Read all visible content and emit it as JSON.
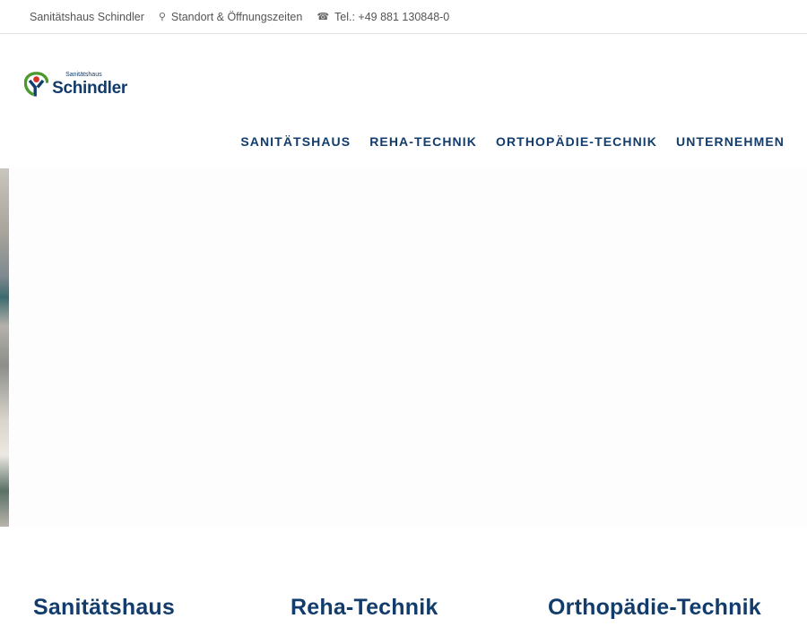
{
  "topbar": {
    "company": "Sanitätshaus Schindler",
    "location_icon": "map-pin-icon",
    "location": "Standort & Öffnungszeiten",
    "phone_icon": "phone-icon",
    "phone": "Tel.: +49 881 130848-0"
  },
  "logo": {
    "small": "Sanitätshaus",
    "big": "Schindler",
    "colors": {
      "green": "#4a9a2e",
      "red": "#d6322b",
      "blue": "#123c6b"
    }
  },
  "nav": {
    "items": [
      "SANITÄTSHAUS",
      "REHA-TECHNIK",
      "ORTHOPÄDIE-TECHNIK",
      "UNTERNEHMEN"
    ]
  },
  "categories": [
    "Sanitätshaus",
    "Reha-Technik",
    "Orthopädie-Technik"
  ],
  "colors": {
    "brand": "#123c6b",
    "text": "#555555"
  }
}
